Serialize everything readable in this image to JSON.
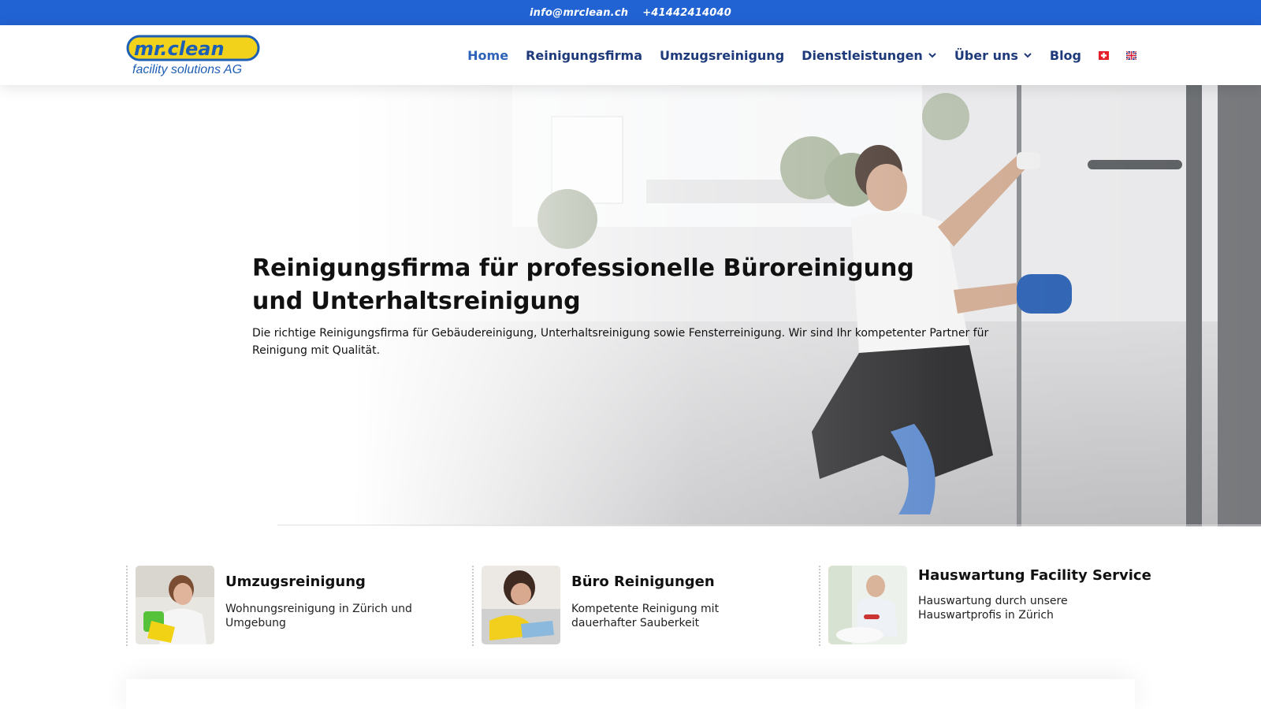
{
  "topbar": {
    "email": "info@mrclean.ch",
    "phone": "+41442414040"
  },
  "logo": {
    "brand": "mr.clean",
    "tagline": "facility solutions AG"
  },
  "nav": {
    "items": [
      {
        "label": "Home",
        "active": true
      },
      {
        "label": "Reinigungsfirma"
      },
      {
        "label": "Umzugsreinigung"
      },
      {
        "label": "Dienstleistungen",
        "dropdown": true
      },
      {
        "label": "Über uns",
        "dropdown": true
      },
      {
        "label": "Blog"
      }
    ],
    "languages": [
      "swiss-flag-icon",
      "uk-flag-icon"
    ]
  },
  "hero": {
    "title": "Reinigungsfirma für professionelle Büroreinigung und Unterhaltsreinigung",
    "text": "Die richtige Reinigungsfirma für Gebäudereinigung, Unterhaltsreinigung sowie Fensterreinigung. Wir sind Ihr kompetenter Partner für Reinigung mit Qualität."
  },
  "services": [
    {
      "title": "Umzugsreinigung",
      "desc": "Wohnungsreinigung in Zürich und Umgebung"
    },
    {
      "title": "Büro Reinigungen",
      "desc": "Kompetente Reinigung mit dauerhafter Sauberkeit"
    },
    {
      "title": "Hauswartung Facility Service",
      "desc": "Hauswartung durch unsere Hauswartprofis in Zürich"
    }
  ],
  "colors": {
    "topbar": "#2263d3",
    "nav_text": "#1e3a7a",
    "nav_active": "#2e63b8",
    "logo_yellow": "#f3d21b"
  }
}
